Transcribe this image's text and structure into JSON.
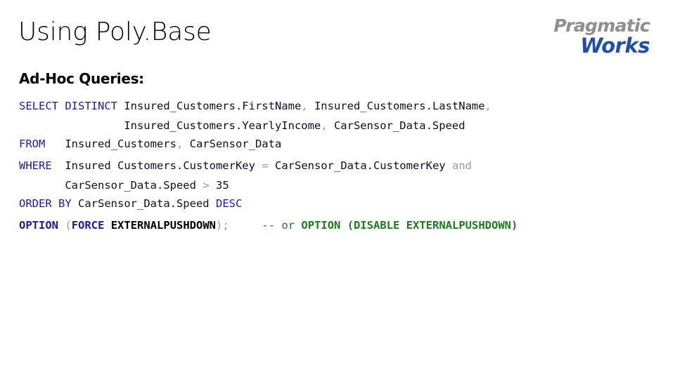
{
  "slide": {
    "title": "Using Poly.Base",
    "section_heading": "Ad-Hoc Queries:",
    "background_color": "#ffffff"
  },
  "logo": {
    "name": "pragmatic-works-logo",
    "line1": "Pragmatic",
    "line2": "Works",
    "line1_color": "#8f8f8f",
    "line2_color": "#1f4fa8"
  },
  "colors": {
    "keyword": "#1a1aa8",
    "identifier": "#0d0d2b",
    "punctuation": "#9a9a9a",
    "comment": "#1d7a20",
    "text": "#000000"
  },
  "code": {
    "language": "sql",
    "full_text": "SELECT DISTINCT Insured_Customers.FirstName, Insured_Customers.LastName,\n                Insured_Customers.YearlyIncome, CarSensor_Data.Speed\nFROM   Insured_Customers, CarSensor_Data\nWHERE  Insured Customers.CustomerKey = CarSensor_Data.CustomerKey and\n       CarSensor_Data.Speed > 35\nORDER BY CarSensor_Data.Speed DESC\nOPTION (FORCE EXTERNALPUSHDOWN);     -- or OPTION (DISABLE EXTERNALPUSHDOWN)",
    "lines": [
      {
        "id": "select-line",
        "tokens": [
          {
            "t": "SELECT DISTINCT",
            "k": "kw"
          },
          {
            "t": " ",
            "k": "plain"
          },
          {
            "t": "Insured_Customers.FirstName",
            "k": "ident"
          },
          {
            "t": ", ",
            "k": "punct"
          },
          {
            "t": "Insured_Customers.LastName",
            "k": "ident"
          },
          {
            "t": ",",
            "k": "punct"
          }
        ]
      },
      {
        "id": "select-line-continued",
        "tokens": [
          {
            "t": "                ",
            "k": "plain"
          },
          {
            "t": "Insured_Customers.YearlyIncome",
            "k": "ident"
          },
          {
            "t": ", ",
            "k": "punct"
          },
          {
            "t": "CarSensor_Data.Speed",
            "k": "ident"
          }
        ]
      },
      {
        "id": "from-line",
        "tokens": [
          {
            "t": "FROM",
            "k": "kw"
          },
          {
            "t": "   ",
            "k": "plain"
          },
          {
            "t": "Insured_Customers",
            "k": "ident"
          },
          {
            "t": ", ",
            "k": "punct"
          },
          {
            "t": "CarSensor_Data",
            "k": "ident"
          }
        ]
      },
      {
        "id": "where-line",
        "tokens": [
          {
            "t": "WHERE",
            "k": "kw"
          },
          {
            "t": "  ",
            "k": "plain"
          },
          {
            "t": "Insured Customers.CustomerKey",
            "k": "ident"
          },
          {
            "t": " ",
            "k": "plain"
          },
          {
            "t": "=",
            "k": "op"
          },
          {
            "t": " ",
            "k": "plain"
          },
          {
            "t": "CarSensor_Data.CustomerKey",
            "k": "ident"
          },
          {
            "t": " ",
            "k": "plain"
          },
          {
            "t": "and",
            "k": "punct"
          }
        ]
      },
      {
        "id": "where-line-continued",
        "tokens": [
          {
            "t": "       ",
            "k": "plain"
          },
          {
            "t": "CarSensor_Data.Speed",
            "k": "ident"
          },
          {
            "t": " ",
            "k": "plain"
          },
          {
            "t": ">",
            "k": "op"
          },
          {
            "t": " ",
            "k": "plain"
          },
          {
            "t": "35",
            "k": "num"
          }
        ]
      },
      {
        "id": "order-by-line",
        "tokens": [
          {
            "t": "ORDER BY",
            "k": "kw"
          },
          {
            "t": " ",
            "k": "plain"
          },
          {
            "t": "CarSensor_Data.Speed",
            "k": "ident"
          },
          {
            "t": " ",
            "k": "plain"
          },
          {
            "t": "DESC",
            "k": "kw"
          }
        ]
      },
      {
        "id": "option-line",
        "tokens": [
          {
            "t": "OPTION",
            "k": "kw-b"
          },
          {
            "t": " ",
            "k": "plain"
          },
          {
            "t": "(",
            "k": "punct"
          },
          {
            "t": "FORCE",
            "k": "kw-b"
          },
          {
            "t": " ",
            "k": "plain"
          },
          {
            "t": "EXTERNALPUSHDOWN",
            "k": "ident-b"
          },
          {
            "t": ")",
            "k": "punct"
          },
          {
            "t": ";",
            "k": "punct"
          },
          {
            "t": "     ",
            "k": "plain"
          },
          {
            "t": "-- or ",
            "k": "comment"
          },
          {
            "t": "OPTION (DISABLE EXTERNALPUSHDOWN)",
            "k": "comment-b"
          }
        ]
      }
    ]
  }
}
